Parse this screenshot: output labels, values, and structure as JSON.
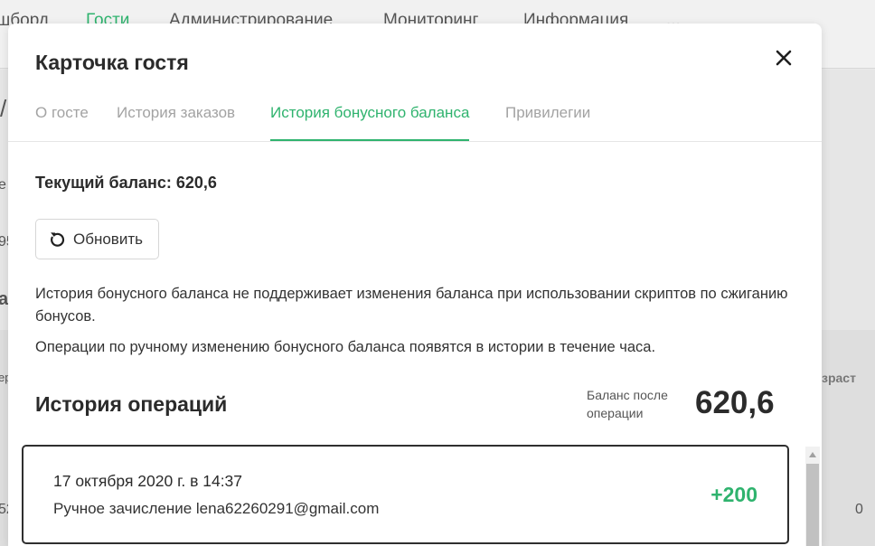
{
  "background": {
    "nav": [
      "шборд",
      "Гости",
      "Администрирование",
      "Мониторинг",
      "Информация",
      "..."
    ],
    "active_nav_index": 1,
    "frag_slash": "/",
    "frag_e": "е",
    "frag_95": "95",
    "frag_a": "а",
    "frag_er": "ер",
    "frag_age": "зраст",
    "frag_52": "52",
    "frag_zero": "0"
  },
  "modal": {
    "title": "Карточка гостя",
    "tabs": [
      {
        "label": "О госте",
        "active": false
      },
      {
        "label": "История заказов",
        "active": false
      },
      {
        "label": "История бонусного баланса",
        "active": true
      },
      {
        "label": "Привилегии",
        "active": false
      }
    ],
    "current_balance": "Текущий баланс: 620,6",
    "refresh_label": "Обновить",
    "info1": "История бонусного баланса не поддерживает изменения баланса при использовании скриптов по сжиганию бонусов.",
    "info2": "Операции по ручному изменению бонусного баланса появятся в истории в течение часа.",
    "operations": {
      "title": "История операций",
      "balance_after_label": "Баланс после операции",
      "balance_after_value": "620,6",
      "items": [
        {
          "date": "17 октября 2020 г. в 14:37",
          "description": "Ручное зачисление lena62260291@gmail.com",
          "amount": "+200"
        }
      ]
    }
  },
  "colors": {
    "accent": "#2fb36e",
    "text": "#2b2b2b",
    "muted": "#a3a3a3"
  },
  "icons": [
    "close-icon",
    "refresh-icon",
    "scroll-up-arrow-icon"
  ]
}
